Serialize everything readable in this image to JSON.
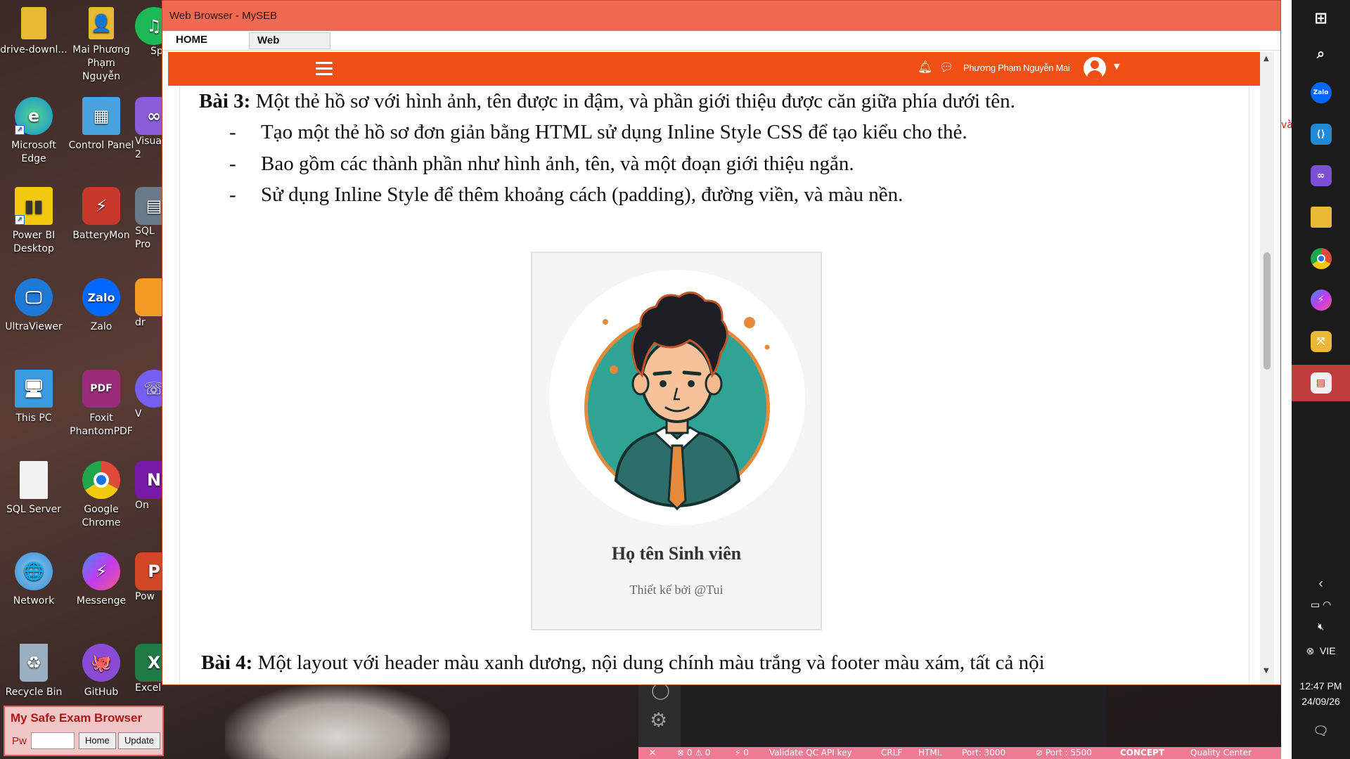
{
  "desktop": {
    "icons": [
      {
        "label": "drive-downl...",
        "icon": "folder-icon",
        "color": "#e8b934"
      },
      {
        "label": "Mai Phương Phạm Nguyễn",
        "icon": "user-folder-icon",
        "color": "#e8b934"
      },
      {
        "label": "Sp",
        "icon": "spotify-icon",
        "color": "#1db954"
      },
      {
        "label": "Microsoft Edge",
        "icon": "edge-icon",
        "color": "#1a8fd6"
      },
      {
        "label": "Control Panel",
        "icon": "control-panel-icon",
        "color": "#4aa3df"
      },
      {
        "label": "Visua 2",
        "icon": "visual-studio-icon",
        "color": "#8a5cd6"
      },
      {
        "label": "Power BI Desktop",
        "icon": "power-bi-icon",
        "color": "#f2c811"
      },
      {
        "label": "BatteryMon",
        "icon": "batterymon-icon",
        "color": "#c8382c"
      },
      {
        "label": "SQL Pro",
        "icon": "sql-profiler-icon",
        "color": "#6a7a8a"
      },
      {
        "label": "UltraViewer",
        "icon": "ultraviewer-icon",
        "color": "#1e7ad6"
      },
      {
        "label": "Zalo",
        "icon": "zalo-icon",
        "color": "#0068ff"
      },
      {
        "label": "dr",
        "icon": "drive-icon",
        "color": "#f29b25"
      },
      {
        "label": "This PC",
        "icon": "this-pc-icon",
        "color": "#3a9ae0"
      },
      {
        "label": "Foxit PhantomPDF",
        "icon": "foxit-icon",
        "color": "#9a2c7a"
      },
      {
        "label": "V",
        "icon": "viber-icon",
        "color": "#7360f2"
      },
      {
        "label": "SQL Server",
        "icon": "document-icon",
        "color": "#f2f2f2"
      },
      {
        "label": "Google Chrome",
        "icon": "chrome-icon",
        "color": "#e04a3a"
      },
      {
        "label": "On",
        "icon": "onenote-icon",
        "color": "#7719aa"
      },
      {
        "label": "Network",
        "icon": "network-icon",
        "color": "#3a8ed6"
      },
      {
        "label": "Messenge",
        "icon": "messenger-icon",
        "color": "#8a3cf0"
      },
      {
        "label": "Pow",
        "icon": "powerpoint-icon",
        "color": "#d24726"
      },
      {
        "label": "Recycle Bin",
        "icon": "recycle-bin-icon",
        "color": "#9ab0c0"
      },
      {
        "label": "GitHub",
        "icon": "github-icon",
        "color": "#8a4cd6"
      },
      {
        "label": "Excel",
        "icon": "excel-icon",
        "color": "#1f7a44"
      }
    ]
  },
  "seb_widget": {
    "title": "My Safe Exam Browser",
    "pw_label": "Pw",
    "home_label": "Home",
    "update_label": "Update"
  },
  "window": {
    "title": "Web Browser - MySEB",
    "tabs": [
      "HOME",
      "Web Browser"
    ]
  },
  "navbar": {
    "user_name": "Phương Phạm Nguyễn Mai"
  },
  "content": {
    "bai3_label": "Bài 3:",
    "bai3_text": " Một thẻ hồ sơ với hình ảnh, tên được in đậm, và phần giới thiệu được căn giữa phía dưới tên.",
    "bullets": [
      "Tạo một thẻ hồ sơ đơn giản bằng HTML sử dụng Inline Style CSS để tạo kiểu cho thẻ.",
      "Bao gồm các thành phần như hình ảnh, tên, và một đoạn giới thiệu ngắn.",
      "Sử dụng Inline Style để thêm khoảng cách (padding), đường viền, và màu nền."
    ],
    "bullet_dash": "-",
    "card_name": "Họ tên Sinh viên",
    "card_desc": "Thiết kế bởi @Tui",
    "bai4_label": "Bài 4:",
    "bai4_text": " Một layout với header màu xanh dương, nội dung chính màu trắng và footer màu xám, tất cả nội"
  },
  "vscode_status": {
    "items": [
      "⊗ 0 ⚠ 0",
      "⚡ 0",
      "Validate QC API key",
      "CRLF",
      "HTML",
      "Port: 3000",
      "⊘ Port : 5500",
      "CONCEPT",
      "Quality Center"
    ]
  },
  "taskbar": {
    "time": "12:47 PM",
    "date": "24/09/26",
    "lang": "VIE"
  }
}
